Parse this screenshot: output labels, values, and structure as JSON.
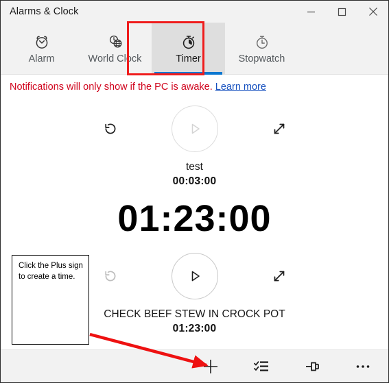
{
  "window": {
    "title": "Alarms & Clock",
    "caption_buttons": [
      {
        "name": "minimize",
        "label": "—"
      },
      {
        "name": "maximize",
        "label": "□"
      },
      {
        "name": "close",
        "label": "✕"
      }
    ]
  },
  "tabs": [
    {
      "label": "Alarm",
      "icon": "alarm-clock-icon",
      "selected": false
    },
    {
      "label": "World Clock",
      "icon": "globe-clock-icon",
      "selected": false
    },
    {
      "label": "Timer",
      "icon": "timer-icon",
      "selected": true
    },
    {
      "label": "Stopwatch",
      "icon": "stopwatch-icon",
      "selected": false
    }
  ],
  "notice": {
    "text": "Notifications will only show if the PC is awake.",
    "link_label": "Learn more"
  },
  "timers": [
    {
      "name": "test",
      "time": "00:03:00",
      "reset_enabled": true,
      "play_enabled": false,
      "expand_icon": "expand-arrows-icon"
    },
    {
      "name": "CHECK BEEF STEW IN CROCK POT",
      "time": "01:23:00",
      "reset_enabled": false,
      "play_enabled": true,
      "expand_icon": "expand-arrows-icon"
    }
  ],
  "big_time": "01:23:00",
  "commandbar": {
    "buttons": [
      {
        "name": "add-timer",
        "icon": "plus-icon",
        "label": "+"
      },
      {
        "name": "edit-timers",
        "icon": "checklist-icon",
        "label": ""
      },
      {
        "name": "pin-timer",
        "icon": "pin-icon",
        "label": ""
      },
      {
        "name": "more-options",
        "icon": "ellipsis-icon",
        "label": "•••"
      }
    ]
  },
  "annotations": {
    "callout_text": "Click the Plus sign to create a time.",
    "highlight_color": "#ef1c1c",
    "arrow_color": "#ee1111"
  },
  "colors": {
    "accent": "#0b78d0",
    "notice_red": "#d0021b",
    "link_blue": "#1550bf",
    "chrome": "#f2f2f2",
    "selected_tab": "#dedede"
  }
}
